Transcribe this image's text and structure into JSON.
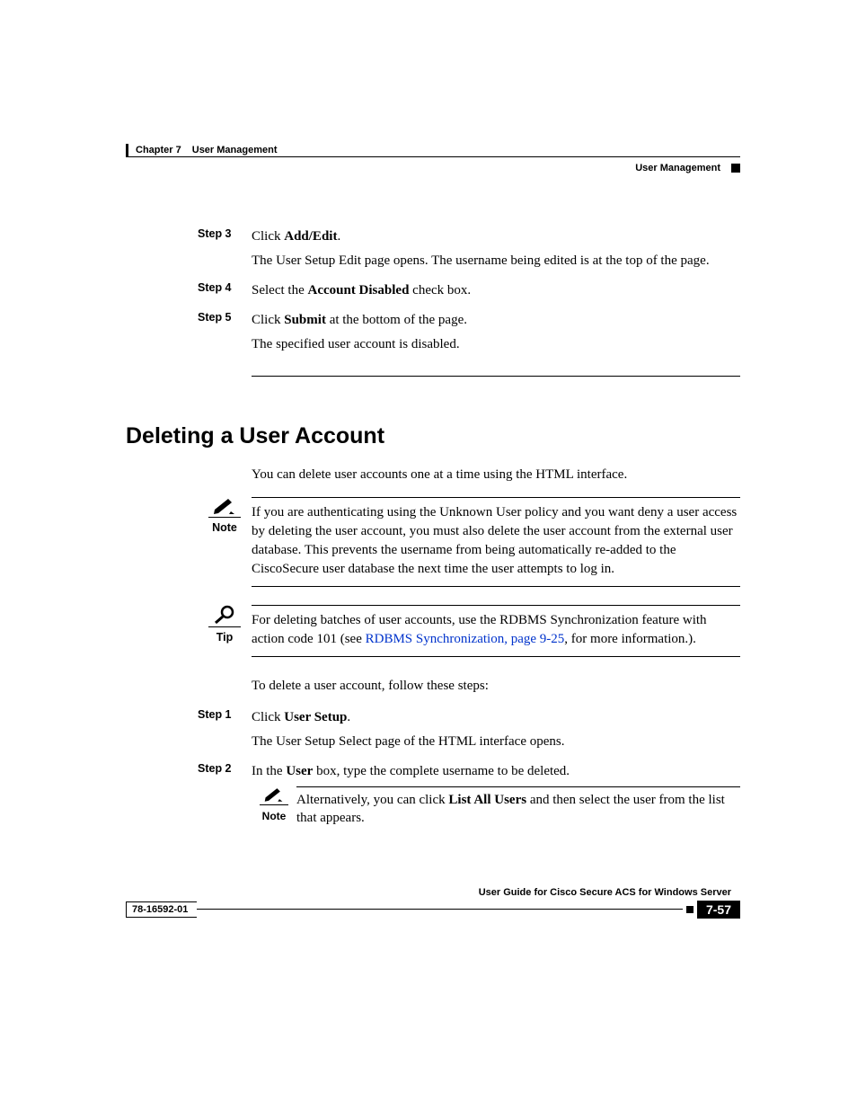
{
  "header": {
    "chapter_label": "Chapter 7",
    "chapter_title": "User Management",
    "running_head": "User Management"
  },
  "upper_steps": {
    "s3": {
      "label": "Step 3",
      "line1_pre": "Click ",
      "line1_b": "Add/Edit",
      "line1_post": ".",
      "line2": "The User Setup Edit page opens. The username being edited is at the top of the page."
    },
    "s4": {
      "label": "Step 4",
      "line1_pre": "Select the ",
      "line1_b": "Account Disabled",
      "line1_post": " check box."
    },
    "s5": {
      "label": "Step 5",
      "line1_pre": "Click ",
      "line1_b": "Submit",
      "line1_post": " at the bottom of the page.",
      "line2": "The specified user account is disabled."
    }
  },
  "section_heading": "Deleting a User Account",
  "intro_p": "You can delete user accounts one at a time using the HTML interface.",
  "note_label": "Note",
  "note_body": "If you are authenticating using the Unknown User policy and you want deny a user access by deleting the user account, you must also delete the user account from the external user database. This prevents the username from being automatically re-added to the CiscoSecure user database the next time the user attempts to log in.",
  "tip_label": "Tip",
  "tip_pre": "For deleting batches of user accounts, use the RDBMS Synchronization feature with action code 101 (see ",
  "tip_link": "RDBMS Synchronization, page 9-25",
  "tip_post": ", for more information.).",
  "lead_in": "To delete a user account, follow these steps:",
  "lower_steps": {
    "s1": {
      "label": "Step 1",
      "line1_pre": "Click ",
      "line1_b": "User Setup",
      "line1_post": ".",
      "line2": "The User Setup Select page of the HTML interface opens."
    },
    "s2": {
      "label": "Step 2",
      "line1_pre": "In the ",
      "line1_b": "User",
      "line1_post": " box, type the complete username to be deleted."
    }
  },
  "nested_note": {
    "label": "Note",
    "pre": "Alternatively, you can click ",
    "b": "List All Users",
    "post": " and then select the user from the list that appears."
  },
  "footer": {
    "guide": "User Guide for Cisco Secure ACS for Windows Server",
    "docnum": "78-16592-01",
    "pagenum": "7-57"
  }
}
